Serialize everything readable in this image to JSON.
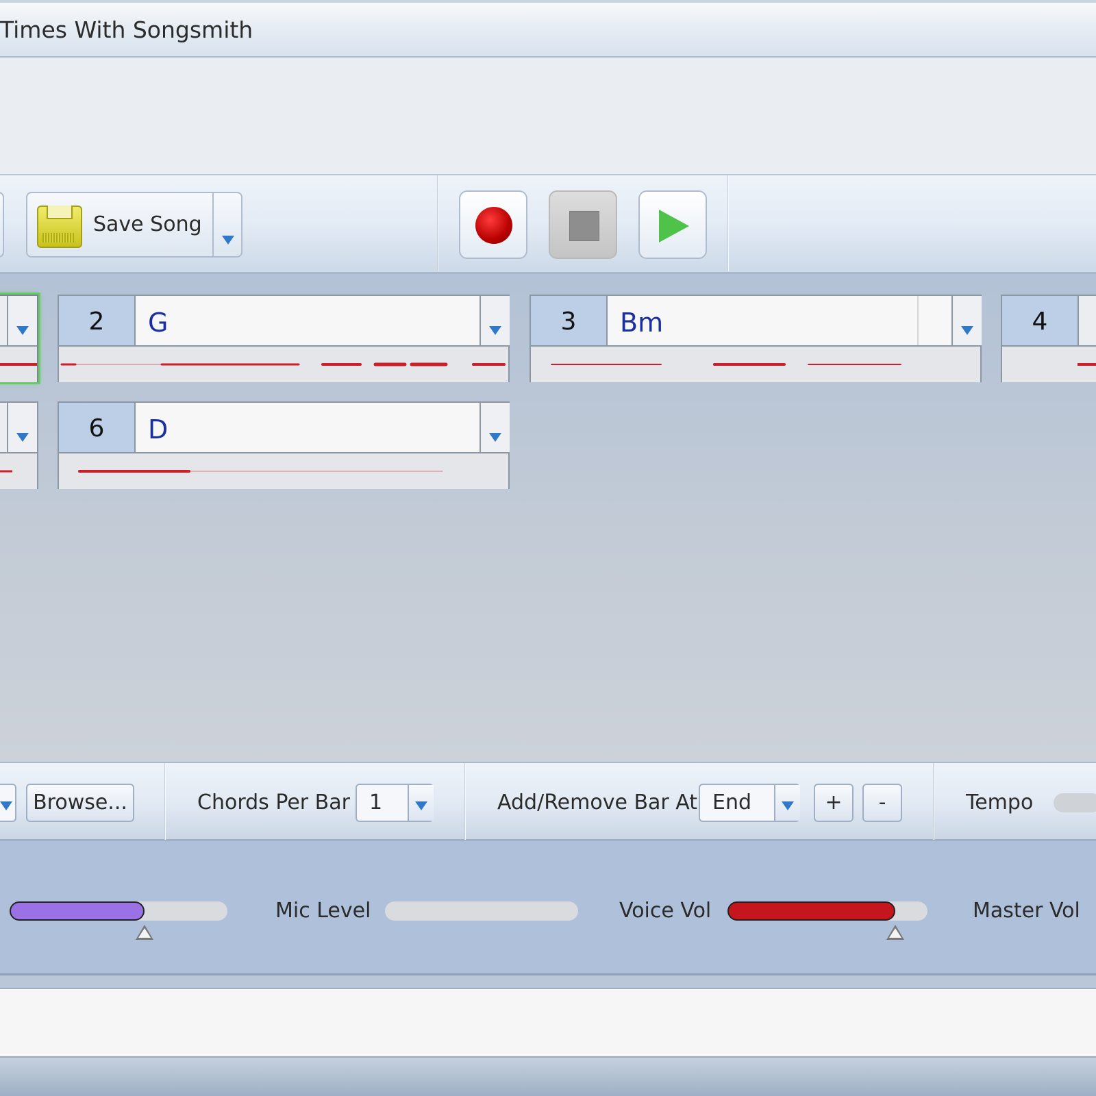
{
  "window": {
    "title": "Times With Songsmith"
  },
  "toolbar": {
    "save_label": "Save Song",
    "record_icon": "record-icon",
    "stop_icon": "stop-icon",
    "play_icon": "play-icon"
  },
  "bars": [
    {
      "number": "2",
      "chord": "G"
    },
    {
      "number": "3",
      "chord": "Bm"
    },
    {
      "number": "4",
      "chord": ""
    },
    {
      "number": "6",
      "chord": "D"
    }
  ],
  "bottom_toolbar": {
    "browse_label": "Browse...",
    "chords_per_bar_label": "Chords Per Bar",
    "chords_per_bar_value": "1",
    "add_remove_label": "Add/Remove Bar At",
    "add_remove_value": "End",
    "add_label": "+",
    "remove_label": "-",
    "tempo_label": "Tempo"
  },
  "levels": {
    "mic_level_label": "Mic Level",
    "voice_vol_label": "Voice Vol",
    "master_vol_label": "Master Vol",
    "first_slider_fraction": 0.62,
    "mic_level_fraction": 0.0,
    "voice_vol_fraction": 0.84
  },
  "colors": {
    "chord_text": "#1a2fa0",
    "first_slider_fill": "#9b72e6",
    "voice_fill": "#c4161c",
    "waveform": "#cc1f2b",
    "record": "#c40000",
    "play": "#4fc24a",
    "selected_bar_border": "#6cc96a"
  }
}
